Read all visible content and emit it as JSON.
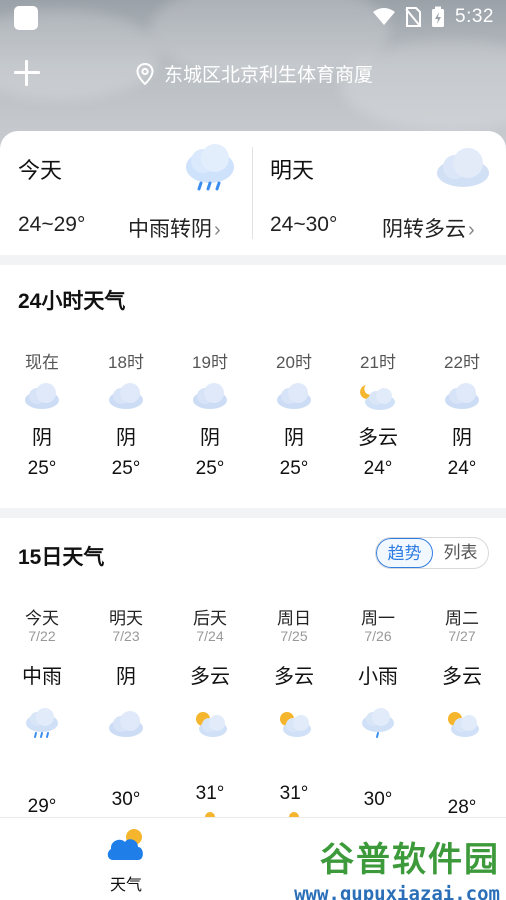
{
  "status_bar": {
    "time": "5:32"
  },
  "header": {
    "location": "东城区北京利生体育商厦"
  },
  "today": {
    "name": "今天",
    "temp": "24~29°",
    "condition": "中雨转阴",
    "icon": "rain-cloud-icon"
  },
  "tomorrow": {
    "name": "明天",
    "temp": "24~30°",
    "condition": "阴转多云",
    "icon": "cloud-icon"
  },
  "hourly": {
    "title": "24小时天气",
    "items": [
      {
        "time": "现在",
        "condition": "阴",
        "temp": "25°",
        "icon": "cloud-icon"
      },
      {
        "time": "18时",
        "condition": "阴",
        "temp": "25°",
        "icon": "cloud-icon"
      },
      {
        "time": "19时",
        "condition": "阴",
        "temp": "25°",
        "icon": "cloud-icon"
      },
      {
        "time": "20时",
        "condition": "阴",
        "temp": "25°",
        "icon": "cloud-icon"
      },
      {
        "time": "21时",
        "condition": "多云",
        "temp": "24°",
        "icon": "moon-cloud-icon"
      },
      {
        "time": "22时",
        "condition": "阴",
        "temp": "24°",
        "icon": "cloud-icon"
      }
    ]
  },
  "daily": {
    "title": "15日天气",
    "toggle": {
      "trend": "趋势",
      "list": "列表"
    },
    "items": [
      {
        "name": "今天",
        "date": "7/22",
        "condition": "中雨",
        "high": "29°",
        "icon": "rain-cloud-icon"
      },
      {
        "name": "明天",
        "date": "7/23",
        "condition": "阴",
        "high": "30°",
        "icon": "cloud-icon"
      },
      {
        "name": "后天",
        "date": "7/24",
        "condition": "多云",
        "high": "31°",
        "icon": "sun-cloud-icon"
      },
      {
        "name": "周日",
        "date": "7/25",
        "condition": "多云",
        "high": "31°",
        "icon": "sun-cloud-icon"
      },
      {
        "name": "周一",
        "date": "7/26",
        "condition": "小雨",
        "high": "30°",
        "icon": "rain-cloud-icon"
      },
      {
        "name": "周二",
        "date": "7/27",
        "condition": "多云",
        "high": "28°",
        "icon": "sun-cloud-icon"
      }
    ]
  },
  "bottom_nav": {
    "weather_label": "天气"
  },
  "watermark": {
    "title": "谷普软件园",
    "url": "www.gupuxiazai.com"
  }
}
